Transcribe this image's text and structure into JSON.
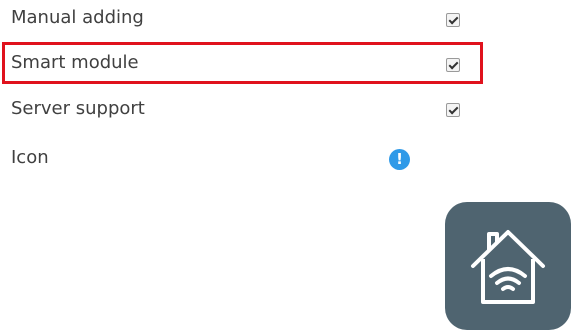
{
  "settings": {
    "rows": [
      {
        "label": "Manual adding",
        "checked": true,
        "control": "checkbox"
      },
      {
        "label": "Smart module",
        "checked": true,
        "control": "checkbox",
        "highlighted": true
      },
      {
        "label": "Server support",
        "checked": true,
        "control": "checkbox"
      },
      {
        "label": "Icon",
        "control": "info-icon"
      }
    ],
    "info_icon_glyph": "!",
    "info_icon_color": "#2f9ae8",
    "highlight_color": "#e0121d"
  },
  "app_icon": {
    "icon_name": "smart-home-wifi-icon",
    "tile_color": "#4f6470"
  }
}
